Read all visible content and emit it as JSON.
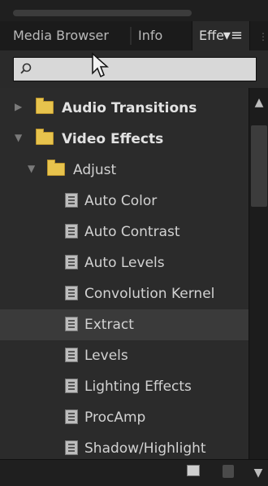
{
  "tabs": [
    {
      "label": "Media Browser"
    },
    {
      "label": "Info"
    },
    {
      "label": "Effe"
    }
  ],
  "search": {
    "placeholder": "",
    "value": ""
  },
  "tree": {
    "items": [
      {
        "label": "Audio Transitions"
      },
      {
        "label": "Video Effects"
      },
      {
        "label": "Adjust"
      },
      {
        "label": "Auto Color"
      },
      {
        "label": "Auto Contrast"
      },
      {
        "label": "Auto Levels"
      },
      {
        "label": "Convolution Kernel"
      },
      {
        "label": "Extract"
      },
      {
        "label": "Levels"
      },
      {
        "label": "Lighting Effects"
      },
      {
        "label": "ProcAmp"
      },
      {
        "label": "Shadow/Highlight"
      }
    ]
  },
  "icons": {
    "search": "search-icon",
    "menu": "panel-menu-icon",
    "folder": "folder-icon",
    "effect": "effect-icon"
  },
  "colors": {
    "folder": "#e7c34d",
    "panel_bg": "#2a2a2a"
  }
}
